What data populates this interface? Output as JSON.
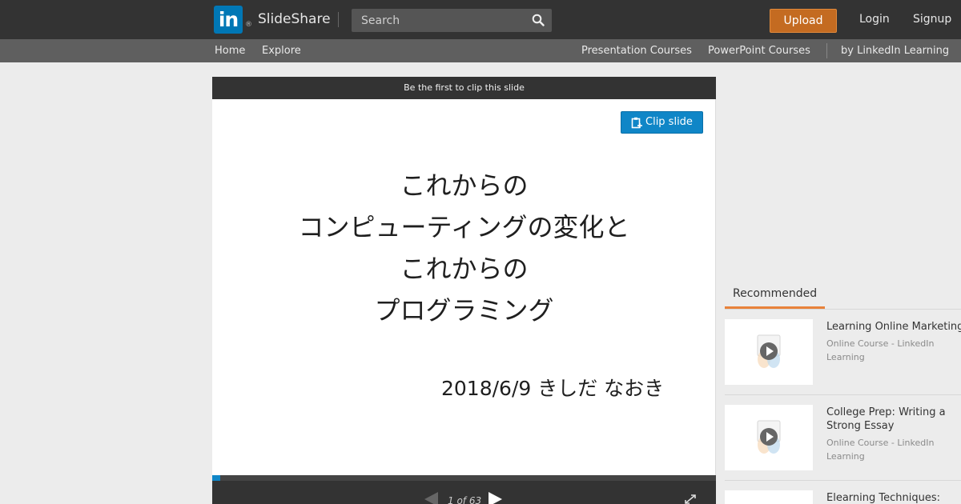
{
  "header": {
    "logo_text": "in",
    "logo_mark": "®",
    "brand": "SlideShare",
    "search_placeholder": "Search",
    "upload_label": "Upload",
    "login_label": "Login",
    "signup_label": "Signup"
  },
  "subnav": {
    "home": "Home",
    "explore": "Explore",
    "presentation_courses": "Presentation Courses",
    "powerpoint_courses": "PowerPoint Courses",
    "linkedin_learning": "by LinkedIn Learning"
  },
  "viewer": {
    "clip_header": "Be the first to clip this slide",
    "clip_button": "Clip slide",
    "slide_title_lines": [
      "これからの",
      "コンピューティングの変化と",
      "これからの",
      "プログラミング"
    ],
    "slide_author": "2018/6/9 きしだ なおき",
    "page_indicator": "1 of 63",
    "progress": 0.0159
  },
  "recommended": {
    "tab_label": "Recommended",
    "items": [
      {
        "title": "Learning Online Marketing",
        "subtitle": "Online Course - LinkedIn Learning"
      },
      {
        "title": "College Prep: Writing a Strong Essay",
        "subtitle": "Online Course - LinkedIn Learning"
      },
      {
        "title": "Elearning Techniques:",
        "subtitle": ""
      }
    ]
  },
  "colors": {
    "topbar": "#333333",
    "subnav": "#5f5f5f",
    "upload": "#c46b21",
    "linkedin_blue": "#0077b5",
    "clip_blue": "#0f86c7",
    "rec_accent": "#e8823a"
  }
}
